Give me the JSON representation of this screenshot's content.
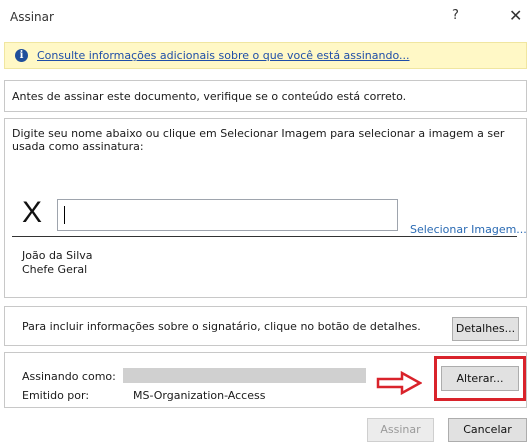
{
  "dialog": {
    "title": "Assinar",
    "help_label": "?",
    "close_label": "✕"
  },
  "infobar": {
    "icon": "info-icon",
    "icon_glyph": "i",
    "link_text": "Consulte informações adicionais sobre o que você está assinando..."
  },
  "verify_text": "Antes de assinar este documento, verifique se o conteúdo está correto.",
  "signature": {
    "instruction": "Digite seu nome abaixo ou clique em Selecionar Imagem para selecionar a imagem a ser usada como assinatura:",
    "x_mark": "X",
    "input_value": "",
    "select_image_link": "Selecionar Imagem...",
    "signer_name": "João da Silva",
    "signer_title": "Chefe Geral"
  },
  "details": {
    "text": "Para incluir informações sobre o signatário, clique no botão de detalhes.",
    "button_label": "Detalhes..."
  },
  "certificate": {
    "signing_as_label": "Assinando como:",
    "signing_as_value": "",
    "issued_by_label": "Emitido por:",
    "issued_by_value": "MS-Organization-Access",
    "change_button_label": "Alterar...",
    "highlight_color": "#d9232b"
  },
  "footer": {
    "sign_button_label": "Assinar",
    "cancel_button_label": "Cancelar"
  }
}
